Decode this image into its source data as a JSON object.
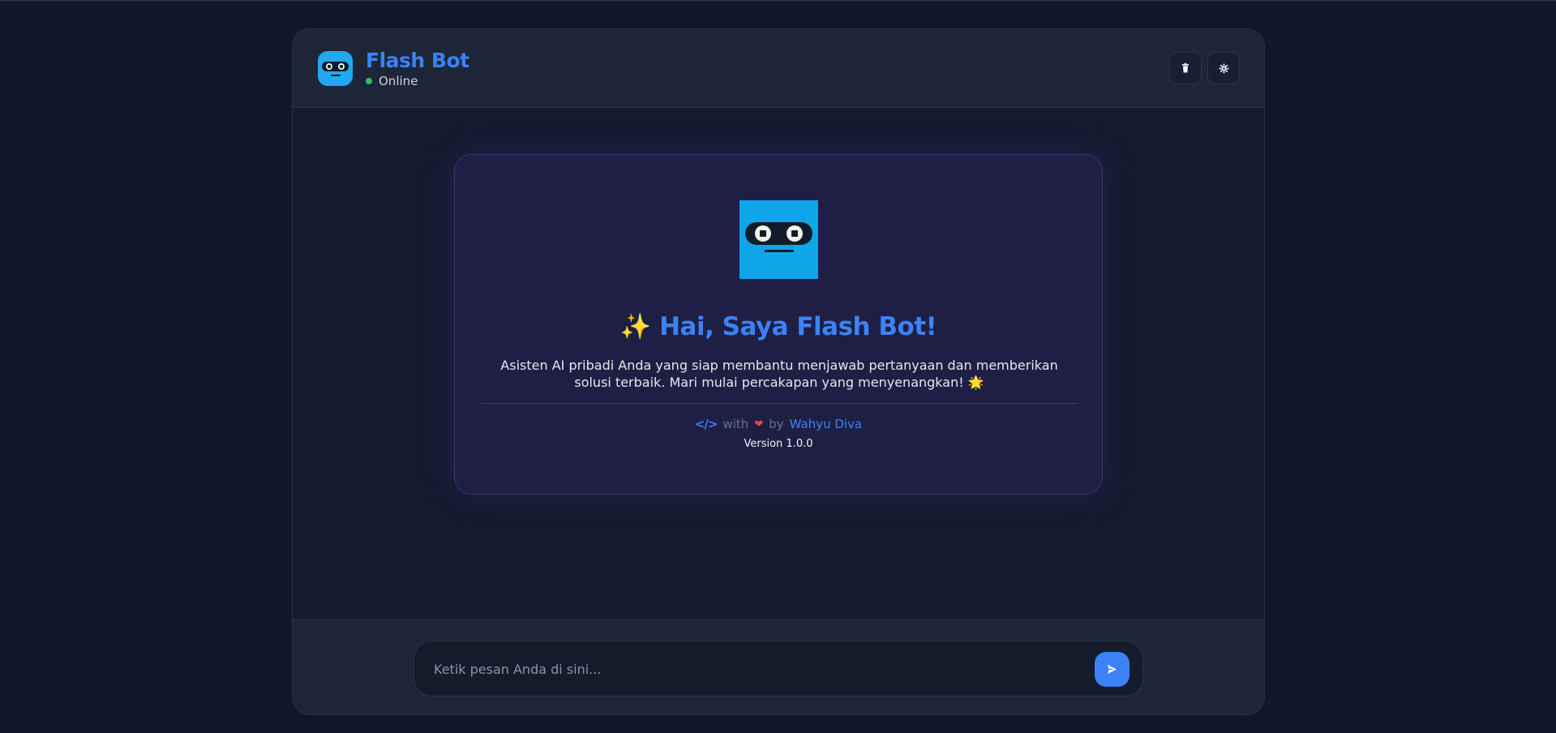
{
  "header": {
    "title": "Flash Bot",
    "status": "Online",
    "clear_icon": "trash-icon",
    "settings_icon": "gear-icon"
  },
  "welcome": {
    "title": "✨ Hai, Saya Flash Bot!",
    "description": "Asisten AI pribadi Anda yang siap membantu menjawab pertanyaan dan memberikan solusi terbaik. Mari mulai percakapan yang menyenangkan! 🌟",
    "credit_code": "</>",
    "credit_with": "with",
    "credit_heart": "❤",
    "credit_by": "by",
    "credit_author": "Wahyu Diva",
    "version": "Version 1.0.0"
  },
  "composer": {
    "placeholder": "Ketik pesan Anda di sini...",
    "value": "",
    "send_icon": "send-icon"
  },
  "colors": {
    "accent": "#3b82f6",
    "online": "#22c55e",
    "bot_face": "#0ea5e9"
  }
}
